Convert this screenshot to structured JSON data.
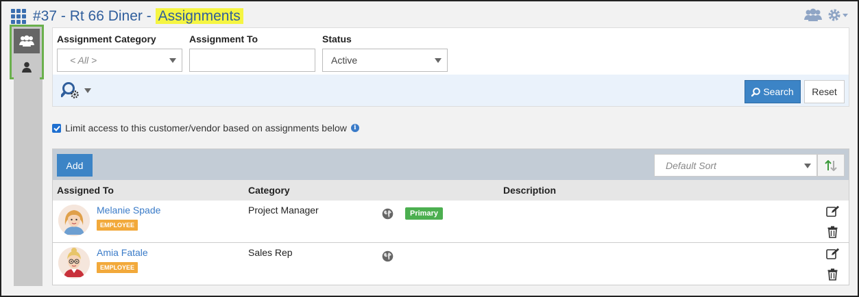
{
  "header": {
    "title_prefix": "#37 - Rt 66 Diner - ",
    "title_highlight": "Assignments"
  },
  "filters": {
    "category_label": "Assignment Category",
    "category_value": "< All >",
    "assign_to_label": "Assignment To",
    "assign_to_value": "",
    "status_label": "Status",
    "status_value": "Active",
    "search_label": "Search",
    "reset_label": "Reset"
  },
  "limit_access": {
    "label": "Limit access to this customer/vendor based on assignments below",
    "checked": true
  },
  "table": {
    "add_label": "Add",
    "sort_placeholder": "Default Sort",
    "columns": {
      "assigned_to": "Assigned To",
      "category": "Category",
      "description": "Description"
    },
    "rows": [
      {
        "name": "Melanie Spade",
        "type_badge": "EMPLOYEE",
        "category": "Project Manager",
        "primary_badge": "Primary",
        "description": ""
      },
      {
        "name": "Amia Fatale",
        "type_badge": "EMPLOYEE",
        "category": "Sales Rep",
        "primary_badge": "",
        "description": ""
      }
    ]
  },
  "colors": {
    "title": "#2f5e9c",
    "highlight": "#f5f542",
    "primary_button": "#3c84c6",
    "employee_badge": "#f2a93b",
    "primary_badge": "#4caf50",
    "sidebar_border": "#6ab04c"
  },
  "icons": {
    "app_grid": "grid-icon",
    "header_people": "people-icon",
    "header_settings": "gear-icon",
    "sidebar_group": "users-group-icon",
    "sidebar_person": "person-icon",
    "advanced_search": "search-gear-icon",
    "search": "magnifier-icon",
    "sort_direction": "sort-arrows-icon",
    "visibility": "globe-icon",
    "edit": "edit-icon",
    "delete": "trash-icon",
    "info": "info-icon"
  }
}
